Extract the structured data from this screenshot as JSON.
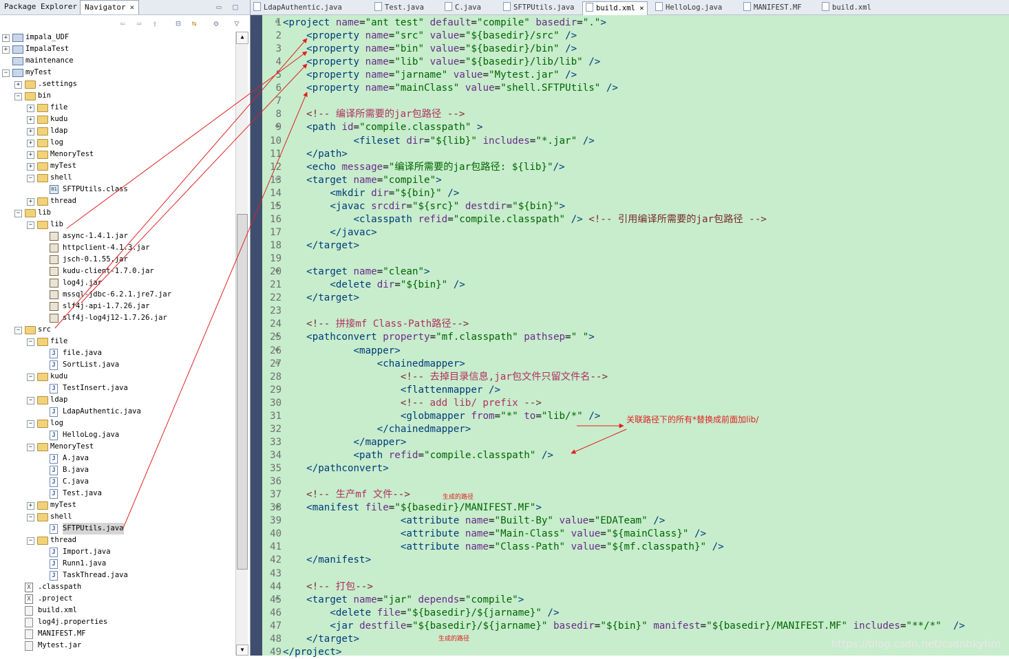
{
  "left_panel": {
    "tabs": [
      {
        "label": "Package Explorer",
        "active": false
      },
      {
        "label": "Navigator",
        "active": true
      }
    ],
    "tree": [
      {
        "label": "impala_UDF",
        "depth": 0,
        "icon": "project",
        "expander": "+"
      },
      {
        "label": "ImpalaTest",
        "depth": 0,
        "icon": "project",
        "expander": "+"
      },
      {
        "label": "maintenance",
        "depth": 0,
        "icon": "project",
        "expander": ""
      },
      {
        "label": "myTest",
        "depth": 0,
        "icon": "project",
        "expander": "−"
      },
      {
        "label": ".settings",
        "depth": 1,
        "icon": "folder",
        "expander": "+"
      },
      {
        "label": "bin",
        "depth": 1,
        "icon": "folder",
        "expander": "−"
      },
      {
        "label": "file",
        "depth": 2,
        "icon": "folder",
        "expander": "+"
      },
      {
        "label": "kudu",
        "depth": 2,
        "icon": "folder",
        "expander": "+"
      },
      {
        "label": "ldap",
        "depth": 2,
        "icon": "folder",
        "expander": "+"
      },
      {
        "label": "log",
        "depth": 2,
        "icon": "folder",
        "expander": "+"
      },
      {
        "label": "MenoryTest",
        "depth": 2,
        "icon": "folder",
        "expander": "+"
      },
      {
        "label": "myTest",
        "depth": 2,
        "icon": "folder",
        "expander": "+"
      },
      {
        "label": "shell",
        "depth": 2,
        "icon": "folder",
        "expander": "−"
      },
      {
        "label": "SFTPUtils.class",
        "depth": 3,
        "icon": "class",
        "expander": ""
      },
      {
        "label": "thread",
        "depth": 2,
        "icon": "folder",
        "expander": "+"
      },
      {
        "label": "lib",
        "depth": 1,
        "icon": "folder",
        "expander": "−"
      },
      {
        "label": "lib",
        "depth": 2,
        "icon": "folder",
        "expander": "−"
      },
      {
        "label": "async-1.4.1.jar",
        "depth": 3,
        "icon": "jar",
        "expander": ""
      },
      {
        "label": "httpclient-4.1.3.jar",
        "depth": 3,
        "icon": "jar",
        "expander": ""
      },
      {
        "label": "jsch-0.1.55.jar",
        "depth": 3,
        "icon": "jar",
        "expander": ""
      },
      {
        "label": "kudu-client-1.7.0.jar",
        "depth": 3,
        "icon": "jar",
        "expander": ""
      },
      {
        "label": "log4j.jar",
        "depth": 3,
        "icon": "jar",
        "expander": ""
      },
      {
        "label": "mssql-jdbc-6.2.1.jre7.jar",
        "depth": 3,
        "icon": "jar",
        "expander": ""
      },
      {
        "label": "slf4j-api-1.7.26.jar",
        "depth": 3,
        "icon": "jar",
        "expander": ""
      },
      {
        "label": "slf4j-log4j12-1.7.26.jar",
        "depth": 3,
        "icon": "jar",
        "expander": ""
      },
      {
        "label": "src",
        "depth": 1,
        "icon": "folder",
        "expander": "−"
      },
      {
        "label": "file",
        "depth": 2,
        "icon": "folder",
        "expander": "−"
      },
      {
        "label": "file.java",
        "depth": 3,
        "icon": "java",
        "expander": ""
      },
      {
        "label": "SortList.java",
        "depth": 3,
        "icon": "java",
        "expander": ""
      },
      {
        "label": "kudu",
        "depth": 2,
        "icon": "folder",
        "expander": "−"
      },
      {
        "label": "TestInsert.java",
        "depth": 3,
        "icon": "java",
        "expander": ""
      },
      {
        "label": "ldap",
        "depth": 2,
        "icon": "folder",
        "expander": "−"
      },
      {
        "label": "LdapAuthentic.java",
        "depth": 3,
        "icon": "java",
        "expander": ""
      },
      {
        "label": "log",
        "depth": 2,
        "icon": "folder",
        "expander": "−"
      },
      {
        "label": "HelloLog.java",
        "depth": 3,
        "icon": "java",
        "expander": ""
      },
      {
        "label": "MenoryTest",
        "depth": 2,
        "icon": "folder",
        "expander": "−"
      },
      {
        "label": "A.java",
        "depth": 3,
        "icon": "java",
        "expander": ""
      },
      {
        "label": "B.java",
        "depth": 3,
        "icon": "java",
        "expander": ""
      },
      {
        "label": "C.java",
        "depth": 3,
        "icon": "java",
        "expander": ""
      },
      {
        "label": "Test.java",
        "depth": 3,
        "icon": "java",
        "expander": ""
      },
      {
        "label": "myTest",
        "depth": 2,
        "icon": "folder",
        "expander": "+"
      },
      {
        "label": "shell",
        "depth": 2,
        "icon": "folder",
        "expander": "−"
      },
      {
        "label": "SFTPUtils.java",
        "depth": 3,
        "icon": "java",
        "expander": "",
        "selected": true
      },
      {
        "label": "thread",
        "depth": 2,
        "icon": "folder",
        "expander": "−"
      },
      {
        "label": "Import.java",
        "depth": 3,
        "icon": "java",
        "expander": ""
      },
      {
        "label": "Runn1.java",
        "depth": 3,
        "icon": "java",
        "expander": ""
      },
      {
        "label": "TaskThread.java",
        "depth": 3,
        "icon": "java",
        "expander": ""
      },
      {
        "label": ".classpath",
        "depth": 1,
        "icon": "xml",
        "expander": ""
      },
      {
        "label": ".project",
        "depth": 1,
        "icon": "xml",
        "expander": ""
      },
      {
        "label": "build.xml",
        "depth": 1,
        "icon": "ant",
        "expander": ""
      },
      {
        "label": "log4j.properties",
        "depth": 1,
        "icon": "file",
        "expander": ""
      },
      {
        "label": "MANIFEST.MF",
        "depth": 1,
        "icon": "file",
        "expander": ""
      },
      {
        "label": "Mytest.jar",
        "depth": 1,
        "icon": "file",
        "expander": ""
      }
    ]
  },
  "editor": {
    "tabs": [
      {
        "label": "LdapAuthentic.java",
        "active": false
      },
      {
        "label": "Test.java",
        "active": false
      },
      {
        "label": "C.java",
        "active": false
      },
      {
        "label": "SFTPUtils.java",
        "active": false
      },
      {
        "label": "build.xml",
        "active": true
      },
      {
        "label": "HelloLog.java",
        "active": false
      },
      {
        "label": "MANIFEST.MF",
        "active": false
      },
      {
        "label": "build.xml",
        "active": false
      }
    ],
    "lines": [
      {
        "n": "1",
        "fold": "⊖",
        "text": "<project name=\"ant test\" default=\"compile\" basedir=\".\">"
      },
      {
        "n": "2",
        "text": "    <property name=\"src\" value=\"${basedir}/src\" />"
      },
      {
        "n": "3",
        "text": "    <property name=\"bin\" value=\"${basedir}/bin\" />"
      },
      {
        "n": "4",
        "text": "    <property name=\"lib\" value=\"${basedir}/lib/lib\" />"
      },
      {
        "n": "5",
        "text": "    <property name=\"jarname\" value=\"Mytest.jar\" />"
      },
      {
        "n": "6",
        "text": "    <property name=\"mainClass\" value=\"shell.SFTPUtils\" />"
      },
      {
        "n": "7",
        "text": ""
      },
      {
        "n": "8",
        "text": "    <!-- 编译所需要的jar包路径 -->"
      },
      {
        "n": "9",
        "fold": "⊖",
        "text": "    <path id=\"compile.classpath\" >"
      },
      {
        "n": "10",
        "text": "            <fileset dir=\"${lib}\" includes=\"*.jar\" />"
      },
      {
        "n": "11",
        "text": "    </path>"
      },
      {
        "n": "12",
        "text": "    <echo message=\"编译所需要的jar包路径: ${lib}\"/>"
      },
      {
        "n": "13",
        "fold": "⊖",
        "text": "    <target name=\"compile\">"
      },
      {
        "n": "14",
        "text": "        <mkdir dir=\"${bin}\" />"
      },
      {
        "n": "15",
        "fold": "⊖",
        "text": "        <javac srcdir=\"${src}\" destdir=\"${bin}\">"
      },
      {
        "n": "16",
        "text": "            <classpath refid=\"compile.classpath\" /> <!-- 引用编译所需要的jar包路径 -->"
      },
      {
        "n": "17",
        "text": "        </javac>"
      },
      {
        "n": "18",
        "text": "    </target>"
      },
      {
        "n": "19",
        "text": ""
      },
      {
        "n": "20",
        "fold": "⊖",
        "text": "    <target name=\"clean\">"
      },
      {
        "n": "21",
        "text": "        <delete dir=\"${bin}\" />"
      },
      {
        "n": "22",
        "text": "    </target>"
      },
      {
        "n": "23",
        "text": ""
      },
      {
        "n": "24",
        "text": "    <!-- 拼接mf Class-Path路径-->"
      },
      {
        "n": "25",
        "fold": "⊖",
        "text": "    <pathconvert property=\"mf.classpath\" pathsep=\" \">"
      },
      {
        "n": "26",
        "fold": "⊖",
        "text": "            <mapper>"
      },
      {
        "n": "27",
        "fold": "⊖",
        "text": "                <chainedmapper>"
      },
      {
        "n": "28",
        "text": "                    <!-- 去掉目录信息,jar包文件只留文件名-->"
      },
      {
        "n": "29",
        "text": "                    <flattenmapper />"
      },
      {
        "n": "30",
        "text": "                    <!-- add lib/ prefix -->"
      },
      {
        "n": "31",
        "text": "                    <globmapper from=\"*\" to=\"lib/*\" />"
      },
      {
        "n": "32",
        "text": "                </chainedmapper>"
      },
      {
        "n": "33",
        "text": "            </mapper>"
      },
      {
        "n": "34",
        "text": "            <path refid=\"compile.classpath\" />"
      },
      {
        "n": "35",
        "text": "    </pathconvert>"
      },
      {
        "n": "36",
        "text": ""
      },
      {
        "n": "37",
        "text": "    <!-- 生产mf 文件-->"
      },
      {
        "n": "38",
        "fold": "⊖",
        "text": "    <manifest file=\"${basedir}/MANIFEST.MF\">"
      },
      {
        "n": "39",
        "text": "                    <attribute name=\"Built-By\" value=\"EDATeam\" />"
      },
      {
        "n": "40",
        "text": "                    <attribute name=\"Main-Class\" value=\"${mainClass}\" />"
      },
      {
        "n": "41",
        "text": "                    <attribute name=\"Class-Path\" value=\"${mf.classpath}\" />"
      },
      {
        "n": "42",
        "text": "    </manifest>"
      },
      {
        "n": "43",
        "text": ""
      },
      {
        "n": "44",
        "text": "    <!-- 打包-->"
      },
      {
        "n": "45",
        "fold": "⊖",
        "text": "    <target name=\"jar\" depends=\"compile\">"
      },
      {
        "n": "46",
        "text": "        <delete file=\"${basedir}/${jarname}\" />"
      },
      {
        "n": "47",
        "text": "        <jar destfile=\"${basedir}/${jarname}\" basedir=\"${bin}\" manifest=\"${basedir}/MANIFEST.MF\" includes=\"**/*\"  />"
      },
      {
        "n": "48",
        "text": "    </target>"
      },
      {
        "n": "49",
        "text": "</project>"
      }
    ]
  },
  "annotations": {
    "globmapper_note": "关联路径下的所有*替换成前面加lib/",
    "manifest_note": "生成的路径",
    "jar_note": "生成的路径"
  },
  "watermark": "https://blog.csdn.net/csdnbkyhm",
  "colors": {
    "editor_background": "#c7edcc",
    "tag": "#003a7a",
    "attribute": "#6a2a8a",
    "value": "#006400",
    "comment": "#7a2a2a",
    "annotation": "#e02020"
  }
}
